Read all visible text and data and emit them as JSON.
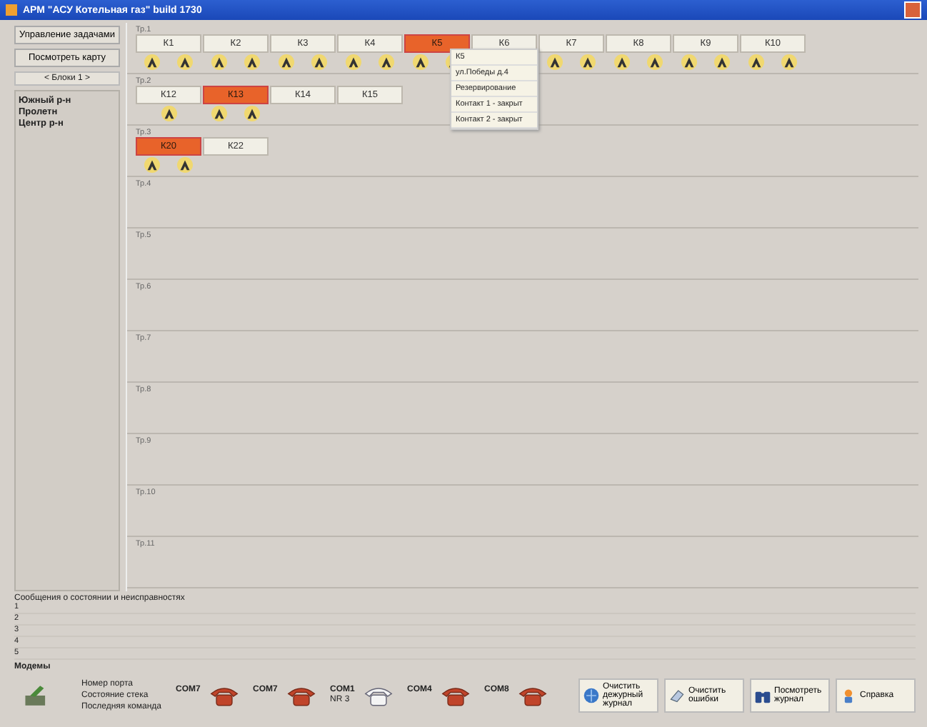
{
  "window": {
    "title": "АРМ \"АСУ Котельная газ\"  build 1730"
  },
  "sidebar": {
    "buttons": [
      "Управление задачами",
      "Посмотреть карту"
    ],
    "group": "< Блоки 1 >",
    "tree": [
      {
        "label": "Южный р-н"
      },
      {
        "label": "Пролетн"
      },
      {
        "label": "Центр р-н"
      }
    ]
  },
  "rows": [
    {
      "label": "Тр.1",
      "boilers": [
        {
          "label": "К1",
          "alarm": false,
          "burners": [
            {
              "lit": true
            },
            {
              "lit": true
            }
          ]
        },
        {
          "label": "К2",
          "alarm": false,
          "burners": [
            {
              "lit": true
            },
            {
              "lit": true
            }
          ]
        },
        {
          "label": "К3",
          "alarm": false,
          "burners": [
            {
              "lit": true
            },
            {
              "lit": true
            }
          ]
        },
        {
          "label": "К4",
          "alarm": false,
          "burners": [
            {
              "lit": true
            },
            {
              "lit": true
            }
          ]
        },
        {
          "label": "К5",
          "alarm": true,
          "burners": [
            {
              "lit": true
            },
            {
              "lit": true
            }
          ]
        },
        {
          "label": "К6",
          "alarm": false
        },
        {
          "label": "К7",
          "alarm": false,
          "burners": [
            {
              "lit": true
            },
            {
              "lit": true
            }
          ]
        },
        {
          "label": "К8",
          "alarm": false,
          "burners": [
            {
              "lit": true
            },
            {
              "lit": true
            }
          ]
        },
        {
          "label": "К9",
          "alarm": false,
          "burners": [
            {
              "lit": true
            },
            {
              "lit": true
            }
          ]
        },
        {
          "label": "К10",
          "alarm": false,
          "burners": [
            {
              "lit": true
            },
            {
              "lit": true
            }
          ]
        }
      ]
    },
    {
      "label": "Тр.2",
      "boilers": [
        {
          "label": "К12",
          "alarm": false,
          "burners": [
            {
              "lit": true
            }
          ]
        },
        {
          "label": "К13",
          "alarm": true,
          "burners": [
            {
              "lit": true
            },
            {
              "lit": true
            }
          ]
        },
        {
          "label": "К14",
          "alarm": false
        },
        {
          "label": "К15",
          "alarm": false
        }
      ]
    },
    {
      "label": "Тр.3",
      "boilers": [
        {
          "label": "К20",
          "alarm": true,
          "burners": [
            {
              "lit": true
            },
            {
              "lit": true
            }
          ]
        },
        {
          "label": "К22",
          "alarm": false
        }
      ]
    },
    {
      "label": "Тр.4",
      "boilers": []
    },
    {
      "label": "Тр.5",
      "boilers": []
    },
    {
      "label": "Тр.6",
      "boilers": []
    },
    {
      "label": "Тр.7",
      "boilers": []
    },
    {
      "label": "Тр.8",
      "boilers": []
    },
    {
      "label": "Тр.9",
      "boilers": []
    },
    {
      "label": "Тр.10",
      "boilers": []
    },
    {
      "label": "Тр.11",
      "boilers": []
    }
  ],
  "popup_menu": {
    "items": [
      "К5",
      "ул.Победы д.4",
      "Резервирование",
      "Контакт 1 - закрыт",
      "Контакт 2 - закрыт"
    ]
  },
  "messages": {
    "title": "Сообщения о состоянии и неисправностях",
    "lines": [
      "1",
      "2",
      "3",
      "4",
      "5"
    ]
  },
  "modems": {
    "title": "Модемы",
    "fields": [
      "Номер порта",
      "Состояние стека",
      "Последняя команда"
    ],
    "ports": [
      {
        "port": "COM7",
        "busy": true
      },
      {
        "port": "COM7",
        "busy": true
      },
      {
        "port": "COM1",
        "state": "NR 3",
        "busy": false
      },
      {
        "port": "COM4",
        "busy": true
      },
      {
        "port": "COM8",
        "busy": true
      }
    ]
  },
  "actions": [
    {
      "label": "Очистить дежурный журнал",
      "kind": "clear"
    },
    {
      "label": "Очистить ошибки",
      "kind": "errors"
    },
    {
      "label": "Посмотреть журнал",
      "kind": "journal"
    },
    {
      "label": "Справка",
      "kind": "help"
    }
  ]
}
